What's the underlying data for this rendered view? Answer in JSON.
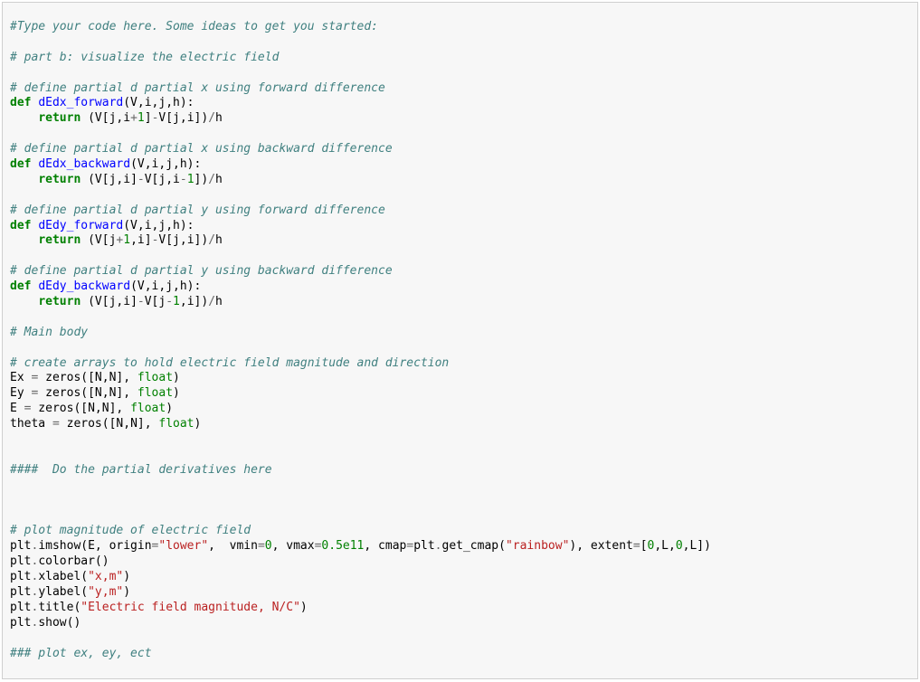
{
  "code": {
    "tokens": [
      [
        [
          "comment",
          "#Type your code here. Some ideas to get you started:"
        ]
      ],
      [
        [
          "ident",
          ""
        ]
      ],
      [
        [
          "comment",
          "# part b: visualize the electric field"
        ]
      ],
      [
        [
          "ident",
          ""
        ]
      ],
      [
        [
          "comment",
          "# define partial d partial x using forward difference"
        ]
      ],
      [
        [
          "keyword",
          "def"
        ],
        [
          "ident",
          " "
        ],
        [
          "funcname",
          "dEdx_forward"
        ],
        [
          "ident",
          "(V,i,j,h):"
        ]
      ],
      [
        [
          "ident",
          "    "
        ],
        [
          "keyword",
          "return"
        ],
        [
          "ident",
          " (V[j,i"
        ],
        [
          "op",
          "+"
        ],
        [
          "number",
          "1"
        ],
        [
          "ident",
          "]"
        ],
        [
          "op",
          "-"
        ],
        [
          "ident",
          "V[j,i])"
        ],
        [
          "op",
          "/"
        ],
        [
          "ident",
          "h"
        ]
      ],
      [
        [
          "ident",
          ""
        ]
      ],
      [
        [
          "comment",
          "# define partial d partial x using backward difference"
        ]
      ],
      [
        [
          "keyword",
          "def"
        ],
        [
          "ident",
          " "
        ],
        [
          "funcname",
          "dEdx_backward"
        ],
        [
          "ident",
          "(V,i,j,h):"
        ]
      ],
      [
        [
          "ident",
          "    "
        ],
        [
          "keyword",
          "return"
        ],
        [
          "ident",
          " (V[j,i]"
        ],
        [
          "op",
          "-"
        ],
        [
          "ident",
          "V[j,i"
        ],
        [
          "op",
          "-"
        ],
        [
          "number",
          "1"
        ],
        [
          "ident",
          "])"
        ],
        [
          "op",
          "/"
        ],
        [
          "ident",
          "h"
        ]
      ],
      [
        [
          "ident",
          ""
        ]
      ],
      [
        [
          "comment",
          "# define partial d partial y using forward difference"
        ]
      ],
      [
        [
          "keyword",
          "def"
        ],
        [
          "ident",
          " "
        ],
        [
          "funcname",
          "dEdy_forward"
        ],
        [
          "ident",
          "(V,i,j,h):"
        ]
      ],
      [
        [
          "ident",
          "    "
        ],
        [
          "keyword",
          "return"
        ],
        [
          "ident",
          " (V[j"
        ],
        [
          "op",
          "+"
        ],
        [
          "number",
          "1"
        ],
        [
          "ident",
          ",i]"
        ],
        [
          "op",
          "-"
        ],
        [
          "ident",
          "V[j,i])"
        ],
        [
          "op",
          "/"
        ],
        [
          "ident",
          "h"
        ]
      ],
      [
        [
          "ident",
          ""
        ]
      ],
      [
        [
          "comment",
          "# define partial d partial y using backward difference"
        ]
      ],
      [
        [
          "keyword",
          "def"
        ],
        [
          "ident",
          " "
        ],
        [
          "funcname",
          "dEdy_backward"
        ],
        [
          "ident",
          "(V,i,j,h):"
        ]
      ],
      [
        [
          "ident",
          "    "
        ],
        [
          "keyword",
          "return"
        ],
        [
          "ident",
          " (V[j,i]"
        ],
        [
          "op",
          "-"
        ],
        [
          "ident",
          "V[j"
        ],
        [
          "op",
          "-"
        ],
        [
          "number",
          "1"
        ],
        [
          "ident",
          ",i])"
        ],
        [
          "op",
          "/"
        ],
        [
          "ident",
          "h"
        ]
      ],
      [
        [
          "ident",
          ""
        ]
      ],
      [
        [
          "comment",
          "# Main body"
        ]
      ],
      [
        [
          "ident",
          ""
        ]
      ],
      [
        [
          "comment",
          "# create arrays to hold electric field magnitude and direction"
        ]
      ],
      [
        [
          "ident",
          "Ex "
        ],
        [
          "op",
          "="
        ],
        [
          "ident",
          " zeros([N,N], "
        ],
        [
          "builtin",
          "float"
        ],
        [
          "ident",
          ")"
        ]
      ],
      [
        [
          "ident",
          "Ey "
        ],
        [
          "op",
          "="
        ],
        [
          "ident",
          " zeros([N,N], "
        ],
        [
          "builtin",
          "float"
        ],
        [
          "ident",
          ")"
        ]
      ],
      [
        [
          "ident",
          "E "
        ],
        [
          "op",
          "="
        ],
        [
          "ident",
          " zeros([N,N], "
        ],
        [
          "builtin",
          "float"
        ],
        [
          "ident",
          ")"
        ]
      ],
      [
        [
          "ident",
          "theta "
        ],
        [
          "op",
          "="
        ],
        [
          "ident",
          " zeros([N,N], "
        ],
        [
          "builtin",
          "float"
        ],
        [
          "ident",
          ")"
        ]
      ],
      [
        [
          "ident",
          ""
        ]
      ],
      [
        [
          "ident",
          ""
        ]
      ],
      [
        [
          "comment",
          "####  Do the partial derivatives here"
        ]
      ],
      [
        [
          "ident",
          ""
        ]
      ],
      [
        [
          "ident",
          ""
        ]
      ],
      [
        [
          "ident",
          ""
        ]
      ],
      [
        [
          "comment",
          "# plot magnitude of electric field"
        ]
      ],
      [
        [
          "ident",
          "plt"
        ],
        [
          "op",
          "."
        ],
        [
          "ident",
          "imshow(E, origin"
        ],
        [
          "op",
          "="
        ],
        [
          "string",
          "\"lower\""
        ],
        [
          "ident",
          ",  vmin"
        ],
        [
          "op",
          "="
        ],
        [
          "number",
          "0"
        ],
        [
          "ident",
          ", vmax"
        ],
        [
          "op",
          "="
        ],
        [
          "number",
          "0.5e11"
        ],
        [
          "ident",
          ", cmap"
        ],
        [
          "op",
          "="
        ],
        [
          "ident",
          "plt"
        ],
        [
          "op",
          "."
        ],
        [
          "ident",
          "get_cmap("
        ],
        [
          "string",
          "\"rainbow\""
        ],
        [
          "ident",
          "), extent"
        ],
        [
          "op",
          "="
        ],
        [
          "ident",
          "["
        ],
        [
          "number",
          "0"
        ],
        [
          "ident",
          ",L,"
        ],
        [
          "number",
          "0"
        ],
        [
          "ident",
          ",L])"
        ]
      ],
      [
        [
          "ident",
          "plt"
        ],
        [
          "op",
          "."
        ],
        [
          "ident",
          "colorbar()"
        ]
      ],
      [
        [
          "ident",
          "plt"
        ],
        [
          "op",
          "."
        ],
        [
          "ident",
          "xlabel("
        ],
        [
          "string",
          "\"x,m\""
        ],
        [
          "ident",
          ")"
        ]
      ],
      [
        [
          "ident",
          "plt"
        ],
        [
          "op",
          "."
        ],
        [
          "ident",
          "ylabel("
        ],
        [
          "string",
          "\"y,m\""
        ],
        [
          "ident",
          ")"
        ]
      ],
      [
        [
          "ident",
          "plt"
        ],
        [
          "op",
          "."
        ],
        [
          "ident",
          "title("
        ],
        [
          "string",
          "\"Electric field magnitude, N/C\""
        ],
        [
          "ident",
          ")"
        ]
      ],
      [
        [
          "ident",
          "plt"
        ],
        [
          "op",
          "."
        ],
        [
          "ident",
          "show()"
        ]
      ],
      [
        [
          "ident",
          ""
        ]
      ],
      [
        [
          "comment",
          "### plot ex, ey, ect"
        ]
      ]
    ]
  }
}
